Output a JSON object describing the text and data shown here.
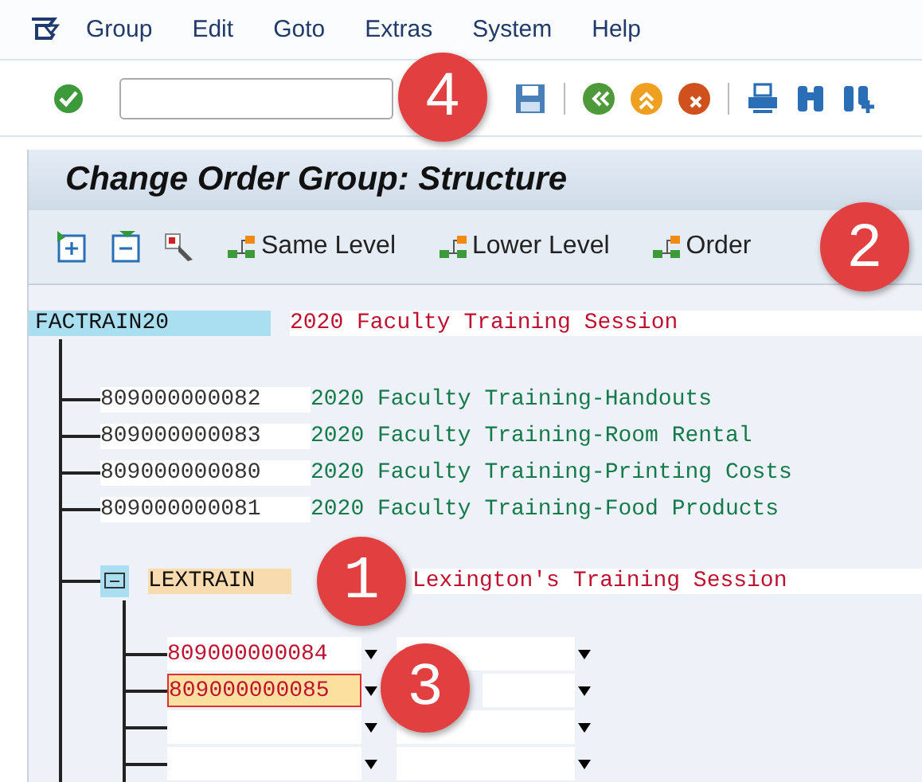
{
  "menu": [
    "Group",
    "Edit",
    "Goto",
    "Extras",
    "System",
    "Help"
  ],
  "title": "Change Order Group: Structure",
  "app_toolbar": [
    {
      "kind": "expand"
    },
    {
      "kind": "collapse"
    },
    {
      "kind": "select"
    },
    {
      "kind": "node",
      "label": "Same Level"
    },
    {
      "kind": "node",
      "label": "Lower Level"
    },
    {
      "kind": "node",
      "label": "Order"
    }
  ],
  "root": {
    "name": "FACTRAIN20",
    "description": "2020 Faculty Training Session",
    "children": [
      {
        "order": "809000000082",
        "description": "2020 Faculty Training-Handouts"
      },
      {
        "order": "809000000083",
        "description": "2020 Faculty Training-Room Rental"
      },
      {
        "order": "809000000080",
        "description": "2020 Faculty Training-Printing Costs"
      },
      {
        "order": "809000000081",
        "description": "2020 Faculty Training-Food Products"
      }
    ],
    "group": {
      "name": "LEXTRAIN",
      "description": "Lexington's Training Session",
      "expanded": true,
      "entries": [
        {
          "from": "809000000084",
          "selected": false
        },
        {
          "from": "809000000085",
          "selected": true
        },
        {
          "selected": false
        },
        {
          "selected": false
        }
      ]
    }
  },
  "callouts": [
    "4",
    "2",
    "1",
    "3"
  ]
}
